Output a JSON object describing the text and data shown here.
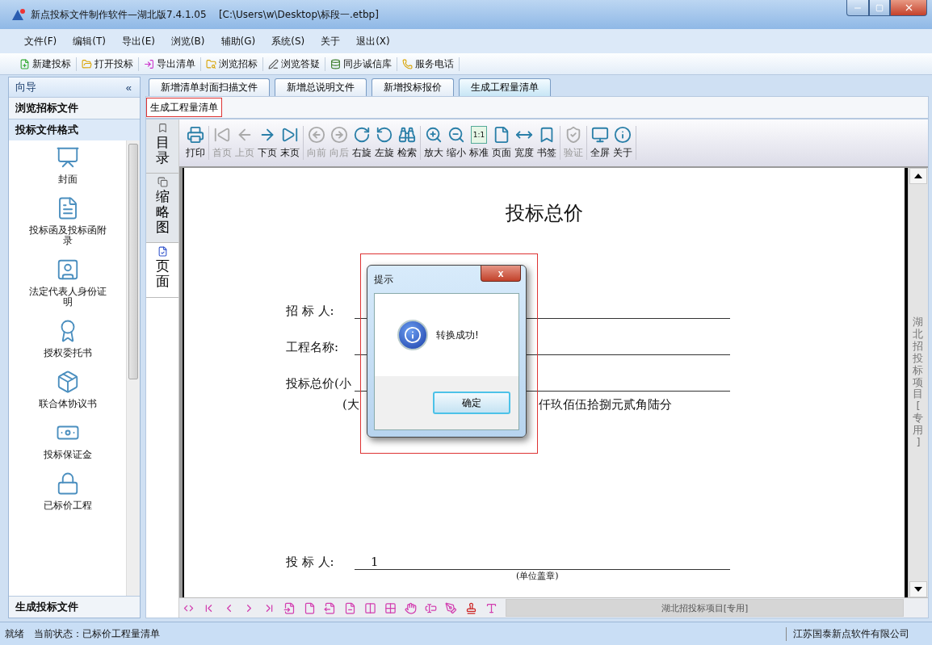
{
  "window": {
    "title": "新点投标文件制作软件—湖北版7.4.1.05    [C:\\Users\\w\\Desktop\\标段一.etbp]"
  },
  "menu": [
    "文件(F)",
    "编辑(T)",
    "导出(E)",
    "浏览(B)",
    "辅助(G)",
    "系统(S)",
    "关于",
    "退出(X)"
  ],
  "toolbar": [
    "新建投标",
    "打开投标",
    "导出清单",
    "浏览招标",
    "浏览答疑",
    "同步诚信库",
    "服务电话"
  ],
  "sidebar": {
    "header": "向导",
    "collapse": "«",
    "sections": [
      {
        "title": "浏览招标文件",
        "expanded": false
      },
      {
        "title": "投标文件格式",
        "expanded": true
      }
    ],
    "items": [
      "封面",
      "投标函及投标函附录",
      "法定代表人身份证明",
      "授权委托书",
      "联合体协议书",
      "投标保证金",
      "已标价工程"
    ],
    "footer": "生成投标文件"
  },
  "tabs": [
    {
      "label": "新增清单封面扫描文件",
      "selected": false
    },
    {
      "label": "新增总说明文件",
      "selected": false
    },
    {
      "label": "新增投标报价",
      "selected": false
    },
    {
      "label": "生成工程量清单",
      "selected": true
    }
  ],
  "subtab": {
    "label": "生成工程量清单"
  },
  "viewer": {
    "side_tabs": [
      {
        "label": "目录",
        "selected": false
      },
      {
        "label": "缩略图",
        "selected": false
      },
      {
        "label": "页面",
        "selected": true
      }
    ],
    "tool_groups": [
      [
        {
          "label": "打印",
          "disabled": false
        }
      ],
      [
        {
          "label": "首页",
          "disabled": true
        },
        {
          "label": "上页",
          "disabled": true
        },
        {
          "label": "下页",
          "disabled": false
        },
        {
          "label": "末页",
          "disabled": false
        }
      ],
      [
        {
          "label": "向前",
          "disabled": true
        },
        {
          "label": "向后",
          "disabled": true
        },
        {
          "label": "右旋",
          "disabled": false
        },
        {
          "label": "左旋",
          "disabled": false
        },
        {
          "label": "检索",
          "disabled": false
        }
      ],
      [
        {
          "label": "放大",
          "disabled": false
        },
        {
          "label": "缩小",
          "disabled": false
        },
        {
          "label": "标准",
          "disabled": false
        },
        {
          "label": "页面",
          "disabled": false
        },
        {
          "label": "宽度",
          "disabled": false
        },
        {
          "label": "书签",
          "disabled": false
        }
      ],
      [
        {
          "label": "验证",
          "disabled": true
        }
      ],
      [
        {
          "label": "全屏",
          "disabled": false
        },
        {
          "label": "关于",
          "disabled": false
        }
      ]
    ],
    "standard_icon_text": "1:1",
    "document": {
      "title": "投标总价",
      "rows": [
        {
          "label": "招 标 人:",
          "value": ""
        },
        {
          "label": "工程名称:",
          "value": ""
        },
        {
          "label": "投标总价(小",
          "value": ""
        }
      ],
      "amount_prefix": "(大",
      "amount_words": "仟玖佰伍拾捌元贰角陆分",
      "bidder_label": "投 标 人:",
      "bidder_value": "1",
      "seal_note": "(单位盖章)"
    },
    "side_mark": "湖北招投标项目[专用]",
    "bottom_mark": "湖北招投标项目[专用]"
  },
  "dialog": {
    "title": "提示",
    "close": "x",
    "message": "转换成功!",
    "button": "确定"
  },
  "status_bar": {
    "ready": "就绪",
    "state": "当前状态：已标价工程量清单",
    "company": "江苏国泰新点软件有限公司"
  }
}
